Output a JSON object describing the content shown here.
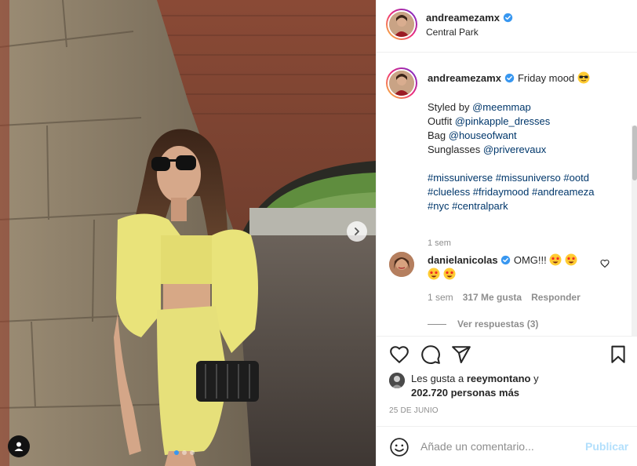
{
  "post": {
    "username": "andreamezamx",
    "location": "Central Park",
    "image_description_icon": "photo",
    "carousel": {
      "total": 3,
      "active": 1
    }
  },
  "caption": {
    "username": "andreamezamx",
    "text": "Friday mood",
    "emoji": "sunglasses-emoji",
    "lines": [
      {
        "prefix": "Styled by ",
        "mention": "@meemmap"
      },
      {
        "prefix": "Outfit ",
        "mention": "@pinkapple_dresses"
      },
      {
        "prefix": "Bag ",
        "mention": "@houseofwant"
      },
      {
        "prefix": "Sunglasses ",
        "mention": "@priverevaux"
      }
    ],
    "hashtag_lines": [
      "#missuniverse #missuniverso #ootd",
      "#clueless #fridaymood #andreameza",
      "#nyc #centralpark"
    ],
    "time": "1 sem"
  },
  "comment": {
    "username": "danielanicolas",
    "text": "OMG!!!",
    "emojis": [
      "star-struck-emoji",
      "star-struck-emoji",
      "star-struck-emoji",
      "star-struck-emoji"
    ],
    "time": "1 sem",
    "likes": "317 Me gusta",
    "reply": "Responder",
    "view_replies": "Ver respuestas (3)"
  },
  "actions": {
    "liked_by_prefix": "Les gusta a ",
    "liked_by_user": "reeymontano",
    "liked_by_joiner": " y",
    "liked_by_others": "202.720 personas más",
    "date": "25 DE JUNIO"
  },
  "add_comment": {
    "placeholder": "Añade un comentario...",
    "publish": "Publicar"
  },
  "colors": {
    "link": "#00376b",
    "verified": "#3897f0",
    "publish_disabled": "#b2dffc",
    "muted": "#8e8e8e"
  }
}
